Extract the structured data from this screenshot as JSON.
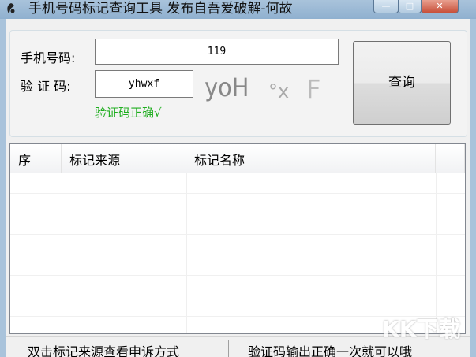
{
  "window": {
    "title": "手机号码标记查询工具 发布自吾爱破解-何故",
    "controls": {
      "minimize": "—",
      "maximize": "□",
      "close": "✕"
    }
  },
  "form": {
    "phone_label": "手机号码:",
    "phone_value": "119",
    "code_label": "验 证 码:",
    "code_value": "yhwxf",
    "captcha_image_text": [
      "yoH",
      "°x",
      "F"
    ],
    "verify_message": "验证码正确√",
    "query_button": "查询"
  },
  "results_table": {
    "columns": [
      "序",
      "标记来源",
      "标记名称",
      ""
    ],
    "rows": []
  },
  "statusbar": {
    "left": "双击标记来源查看申诉方式",
    "right": "验证码输出正确一次就可以哦"
  },
  "watermark": {
    "text": "KK下载"
  },
  "colors": {
    "verify_ok": "#1fae1f",
    "title_bar": "#a9c3db"
  }
}
